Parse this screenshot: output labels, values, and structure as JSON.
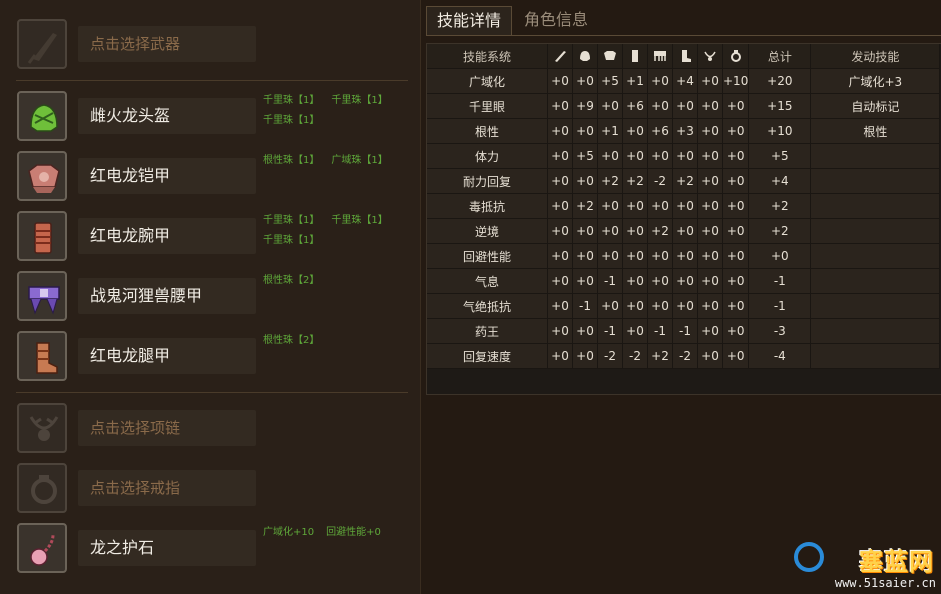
{
  "equipment": [
    {
      "slot": "weapon",
      "name": "点击选择武器",
      "empty": true,
      "icon": "weapon-slot-icon",
      "jewels": []
    },
    {
      "slot": "head",
      "name": "雌火龙头盔",
      "empty": false,
      "icon": "helmet-icon",
      "jewels": [
        "千里珠【1】",
        "千里珠【1】",
        "千里珠【1】"
      ]
    },
    {
      "slot": "chest",
      "name": "红电龙铠甲",
      "empty": false,
      "icon": "chest-armor-icon",
      "jewels": [
        "根性珠【1】",
        "广域珠【1】"
      ]
    },
    {
      "slot": "arms",
      "name": "红电龙腕甲",
      "empty": false,
      "icon": "arm-armor-icon",
      "jewels": [
        "千里珠【1】",
        "千里珠【1】",
        "千里珠【1】"
      ]
    },
    {
      "slot": "waist",
      "name": "战鬼河狸兽腰甲",
      "empty": false,
      "icon": "waist-armor-icon",
      "jewels": [
        "根性珠【2】"
      ]
    },
    {
      "slot": "legs",
      "name": "红电龙腿甲",
      "empty": false,
      "icon": "leg-armor-icon",
      "jewels": [
        "根性珠【2】"
      ]
    },
    {
      "slot": "necklace",
      "name": "点击选择项链",
      "empty": true,
      "icon": "necklace-slot-icon",
      "jewels": []
    },
    {
      "slot": "ring",
      "name": "点击选择戒指",
      "empty": true,
      "icon": "ring-slot-icon",
      "jewels": []
    },
    {
      "slot": "charm",
      "name": "龙之护石",
      "empty": false,
      "icon": "charm-icon",
      "jewels": [
        "广域化+10",
        "回避性能+0"
      ]
    }
  ],
  "tabs": {
    "skill_details": "技能详情",
    "character_info": "角色信息"
  },
  "table": {
    "headers": {
      "skill_system": "技能系统",
      "total": "总计",
      "activated": "发动技能"
    },
    "column_icons": [
      "weapon-icon",
      "helmet-icon",
      "chest-armor-icon",
      "arm-armor-icon",
      "waist-armor-icon",
      "leg-armor-icon",
      "necklace-icon",
      "ring-icon",
      "charm-icon"
    ],
    "rows": [
      {
        "name": "广域化",
        "values": [
          "+0",
          "+0",
          "+5",
          "+1",
          "+0",
          "+4",
          "+0",
          "+10"
        ],
        "total": "+20",
        "skill": "广域化+3"
      },
      {
        "name": "千里眼",
        "values": [
          "+0",
          "+9",
          "+0",
          "+6",
          "+0",
          "+0",
          "+0",
          "+0"
        ],
        "total": "+15",
        "skill": "自动标记"
      },
      {
        "name": "根性",
        "values": [
          "+0",
          "+0",
          "+1",
          "+0",
          "+6",
          "+3",
          "+0",
          "+0"
        ],
        "total": "+10",
        "skill": "根性"
      },
      {
        "name": "体力",
        "values": [
          "+0",
          "+5",
          "+0",
          "+0",
          "+0",
          "+0",
          "+0",
          "+0"
        ],
        "total": "+5",
        "skill": ""
      },
      {
        "name": "耐力回复",
        "values": [
          "+0",
          "+0",
          "+2",
          "+2",
          "-2",
          "+2",
          "+0",
          "+0"
        ],
        "total": "+4",
        "skill": ""
      },
      {
        "name": "毒抵抗",
        "values": [
          "+0",
          "+2",
          "+0",
          "+0",
          "+0",
          "+0",
          "+0",
          "+0"
        ],
        "total": "+2",
        "skill": ""
      },
      {
        "name": "逆境",
        "values": [
          "+0",
          "+0",
          "+0",
          "+0",
          "+2",
          "+0",
          "+0",
          "+0"
        ],
        "total": "+2",
        "skill": ""
      },
      {
        "name": "回避性能",
        "values": [
          "+0",
          "+0",
          "+0",
          "+0",
          "+0",
          "+0",
          "+0",
          "+0"
        ],
        "total": "+0",
        "skill": ""
      },
      {
        "name": "气息",
        "values": [
          "+0",
          "+0",
          "-1",
          "+0",
          "+0",
          "+0",
          "+0",
          "+0"
        ],
        "total": "-1",
        "skill": ""
      },
      {
        "name": "气绝抵抗",
        "values": [
          "+0",
          "-1",
          "+0",
          "+0",
          "+0",
          "+0",
          "+0",
          "+0"
        ],
        "total": "-1",
        "skill": ""
      },
      {
        "name": "药王",
        "values": [
          "+0",
          "+0",
          "-1",
          "+0",
          "-1",
          "-1",
          "+0",
          "+0"
        ],
        "total": "-3",
        "skill": ""
      },
      {
        "name": "回复速度",
        "values": [
          "+0",
          "+0",
          "-2",
          "-2",
          "+2",
          "-2",
          "+0",
          "+0"
        ],
        "total": "-4",
        "skill": ""
      }
    ]
  },
  "watermark": {
    "title": "塞蓝网",
    "url": "www.51saier.cn"
  }
}
